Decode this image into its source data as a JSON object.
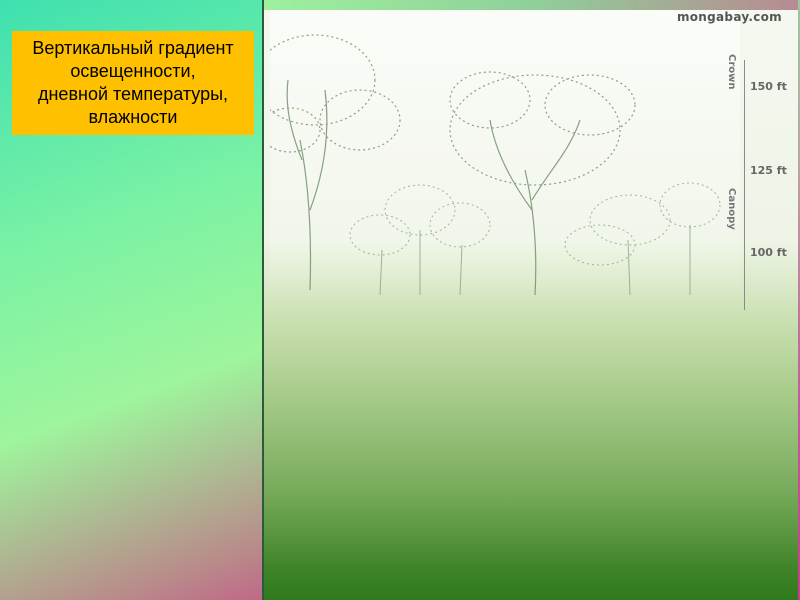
{
  "caption": {
    "text": "Вертикальный градиент\nосвещенности,\nдневной температуры,\nвлажности"
  },
  "image": {
    "watermark": "mongabay.com",
    "scale": {
      "ticks": [
        "150 ft",
        "125 ft",
        "100 ft"
      ],
      "zones": [
        "Crown",
        "Canopy"
      ]
    }
  }
}
